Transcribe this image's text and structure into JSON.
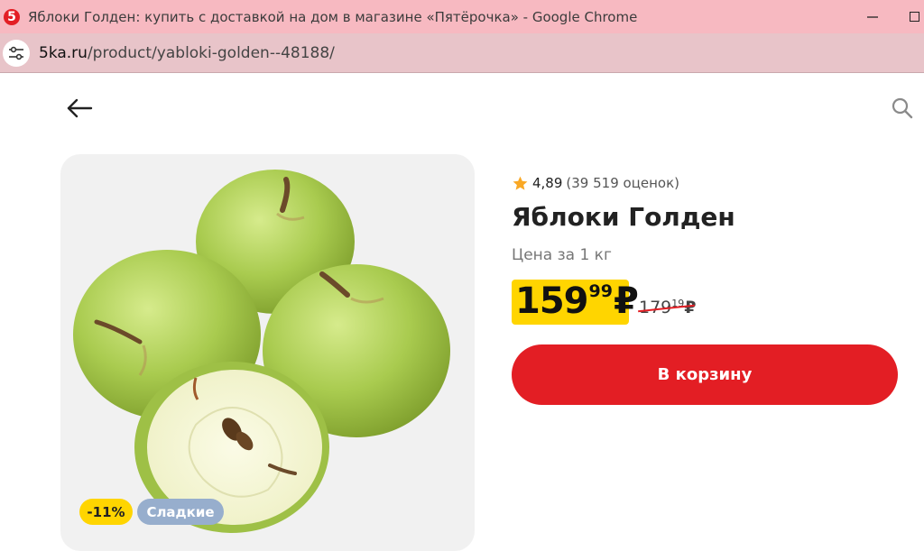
{
  "browser": {
    "window_title": "Яблоки Голден: купить с доставкой на дом в магазине «Пятёрочка» - Google Chrome",
    "favicon_text": "5",
    "url_host": "5ka.ru",
    "url_path": "/product/yabloki-golden--48188/"
  },
  "product": {
    "rating_value": "4,89",
    "rating_count": "(39 519 оценок)",
    "title": "Яблоки Голден",
    "price_unit": "Цена за 1 кг",
    "price_rub": "159",
    "price_kop": "99",
    "currency": "₽",
    "old_price_rub": "179",
    "old_price_kop": "19",
    "add_to_cart": "В корзину",
    "badges": {
      "discount": "-11%",
      "tag": "Сладкие"
    }
  },
  "colors": {
    "brand_red": "#e31e24",
    "price_yellow": "#ffd500",
    "tag_blue": "#97aecd",
    "star": "#f9a825"
  },
  "icons": {
    "back": "arrow-left-icon",
    "search": "search-icon",
    "star": "star-icon",
    "site_settings": "tune-icon"
  }
}
